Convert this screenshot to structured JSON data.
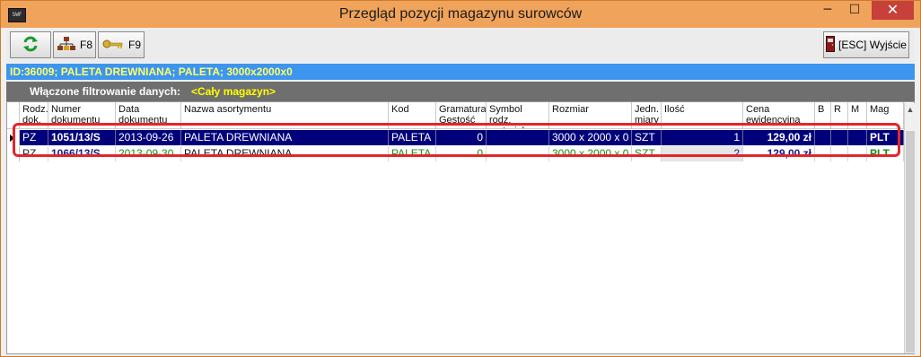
{
  "window": {
    "title": "Przegląd pozycji magazynu surowców",
    "app_icon_text": "SWF",
    "controls": {
      "minimize": "─",
      "maximize": "☐",
      "close": "✕"
    }
  },
  "toolbar": {
    "refresh_label": "",
    "f8_label": "F8",
    "f9_label": "F9",
    "exit_label": "[ESC] Wyjście"
  },
  "info_bar": {
    "text": "ID:36009; PALETA DREWNIANA; PALETA; 3000x2000x0"
  },
  "filter_bar": {
    "label": "Włączone filtrowanie danych:",
    "value": "<Cały magazyn>"
  },
  "grid": {
    "columns": [
      "Rodz. dok.",
      "Numer dokumentu",
      "Data dokumentu",
      "Nazwa asortymentu",
      "Kod",
      "Gramatura/ Gęstość",
      "Symbol rodz. materiału",
      "Rozmiar",
      "Jedn. miary",
      "Ilość",
      "Cena ewidencyjna",
      "B",
      "R",
      "M",
      "Mag"
    ],
    "rows": [
      {
        "rodz": "PZ",
        "numer": "1051/13/S",
        "data": "2013-09-26",
        "nazwa": "PALETA DREWNIANA",
        "kod": "PALETA",
        "gramatura": "0",
        "symbol": "",
        "rozmiar": "3000 x 2000 x 0",
        "jedn": "SZT",
        "ilosc": "1",
        "cena": "129,00 zł",
        "b": "",
        "r": "",
        "m": "",
        "mag": "PLT",
        "selected": true
      },
      {
        "rodz": "PZ",
        "numer": "1066/13/S",
        "data": "2013-09-30",
        "nazwa": "PALETA DREWNIANA",
        "kod": "PALETA",
        "gramatura": "0",
        "symbol": "",
        "rozmiar": "3000 x 2000 x 0",
        "jedn": "SZT",
        "ilosc": "2",
        "cena": "129,00 zł",
        "b": "",
        "r": "",
        "m": "",
        "mag": "PLT",
        "selected": false
      }
    ]
  },
  "colors": {
    "title_bar": "#f0a35a",
    "info_bar": "#3d95ef",
    "info_text": "#ffff66",
    "filter_bar": "#6f6f6f",
    "filter_value": "#ffff00",
    "selected_row": "#00007a",
    "highlight": "#e2262b",
    "date_green": "#1a8a1a",
    "number_blue": "#1a1a8a"
  }
}
